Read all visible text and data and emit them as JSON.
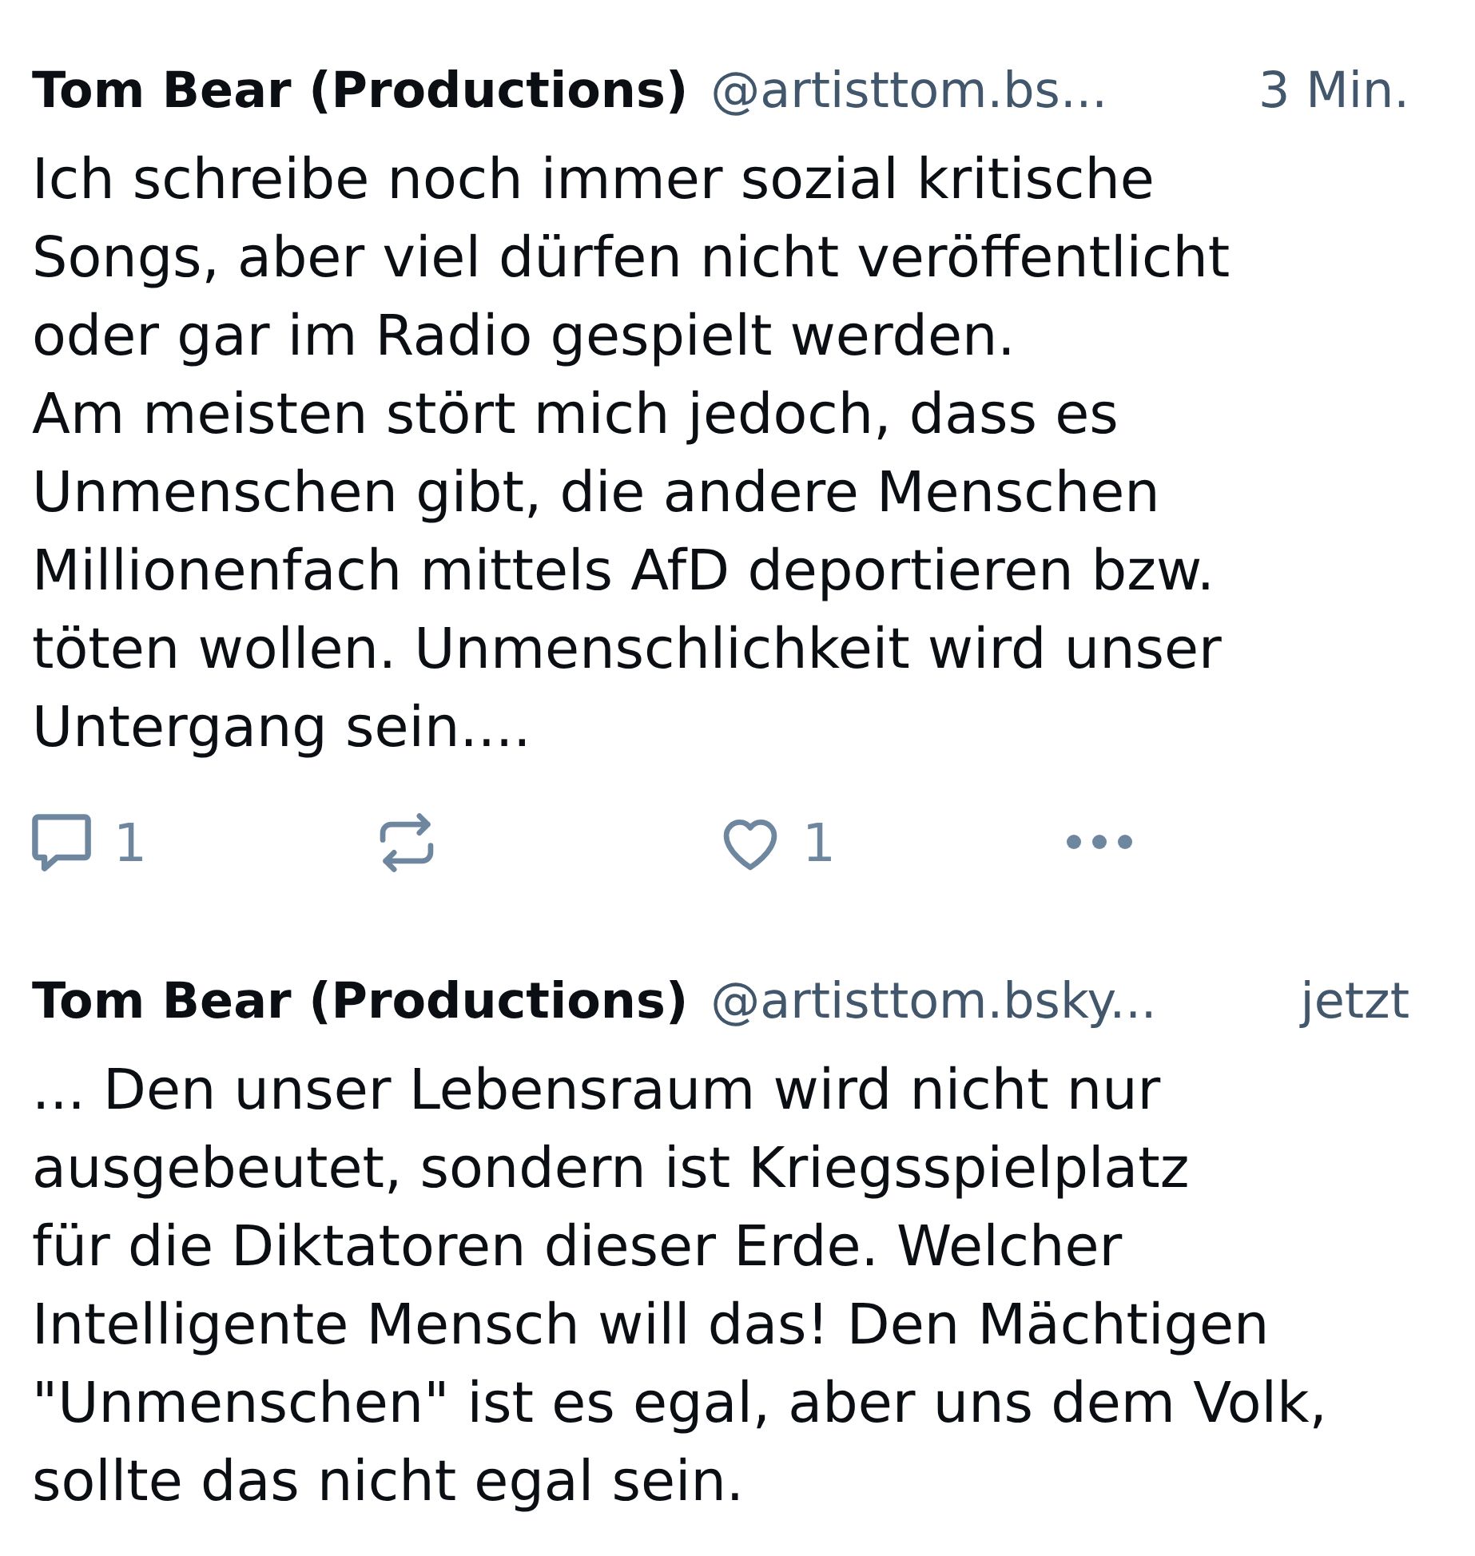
{
  "posts": [
    {
      "author": "Tom Bear (Productions)",
      "handle": "@artisttom.bs...",
      "time": "3 Min.",
      "text": "Ich schreibe noch immer sozial kritische\nSongs, aber viel dürfen nicht veröffentlicht\noder gar im Radio gespielt werden.\nAm meisten stört mich jedoch, dass es\nUnmenschen gibt, die andere Menschen\nMillionenfach mittels AfD deportieren bzw.\ntöten wollen. Unmenschlichkeit wird unser\nUntergang sein....",
      "actions": [
        {
          "kind": "reply",
          "count": "1"
        },
        {
          "kind": "repost"
        },
        {
          "kind": "like",
          "count": "1"
        },
        {
          "kind": "more"
        }
      ]
    },
    {
      "author": "Tom Bear (Productions)",
      "handle": "@artisttom.bsky...",
      "time": "jetzt",
      "text": "... Den unser Lebensraum wird nicht nur\nausgebeutet, sondern ist Kriegsspielplatz\nfür die Diktatoren dieser Erde. Welcher\nIntelligente Mensch will das! Den Mächtigen\n\"Unmenschen\" ist es egal, aber uns dem Volk,\nsollte das nicht egal sein."
    }
  ]
}
